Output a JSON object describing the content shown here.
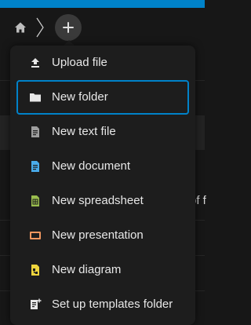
{
  "breadcrumb": {
    "home_icon": "home-icon",
    "add_button_icon": "plus-icon"
  },
  "background": {
    "partial_text": "of f"
  },
  "new_menu": {
    "items": [
      {
        "label": "Upload file",
        "icon": "upload-icon",
        "color": "#e8e8e8"
      },
      {
        "label": "New folder",
        "icon": "folder-icon",
        "color": "#e8e8e8"
      },
      {
        "label": "New text file",
        "icon": "text-file-icon",
        "color": "#9e9e9e"
      },
      {
        "label": "New document",
        "icon": "document-icon",
        "color": "#49abea"
      },
      {
        "label": "New spreadsheet",
        "icon": "spreadsheet-icon",
        "color": "#9abd4e"
      },
      {
        "label": "New presentation",
        "icon": "presentation-icon",
        "color": "#f0965f"
      },
      {
        "label": "New diagram",
        "icon": "diagram-icon",
        "color": "#eed43d"
      },
      {
        "label": "Set up templates folder",
        "icon": "templates-icon",
        "color": "#e8e8e8"
      }
    ],
    "focused_item": "New folder"
  },
  "colors": {
    "accent": "#0082c9",
    "menu_background": "#1d1d1d",
    "page_background": "#171717"
  }
}
